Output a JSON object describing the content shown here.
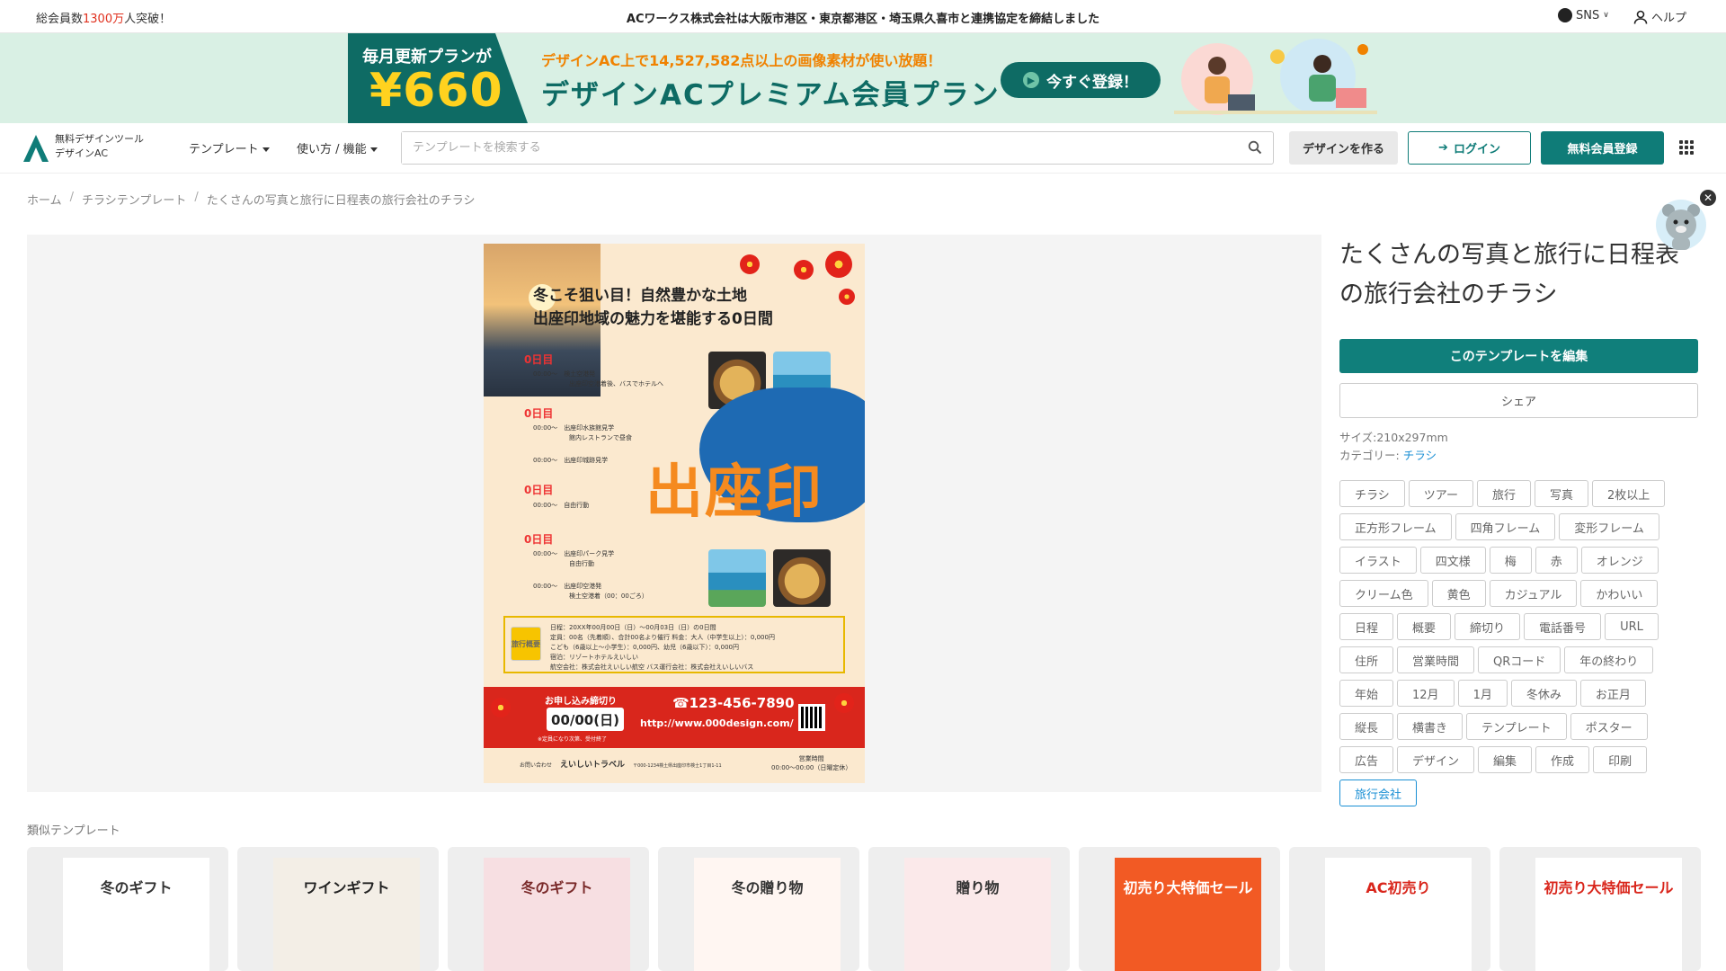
{
  "topbar": {
    "members_prefix": "総会員数",
    "members_count": "1300万",
    "members_suffix": "人突破！",
    "news": "ACワークス株式会社は大阪市港区・東京都港区・埼玉県久喜市と連携協定を締結しました",
    "sns_label": "SNS",
    "help_label": "ヘルプ"
  },
  "promo": {
    "plan_line1": "毎月更新プラン",
    "plan_line1_suffix": "が",
    "price": "¥660",
    "sub": "デザインAC上で14,527,582点以上の画像素材が使い放題！",
    "main": "デザインACプレミアム会員プラン",
    "register": "今すぐ登録！"
  },
  "header": {
    "logo_line1": "無料デザインツール",
    "logo_line2": "デザインAC",
    "nav_templates": "テンプレート",
    "nav_howto": "使い方 / 機能",
    "search_placeholder": "テンプレートを検索する",
    "make_design": "デザインを作る",
    "login": "ログイン",
    "signup": "無料会員登録"
  },
  "breadcrumb": [
    "ホーム",
    "チラシテンプレート",
    "たくさんの写真と旅行に日程表の旅行会社のチラシ"
  ],
  "flyer": {
    "headline1": "冬こそ狙い目！自然豊かな土地",
    "headline2": "出座印地域の魅力を堪能する0日間",
    "day_label": "0日目",
    "schedule": [
      {
        "time": "00:00〜",
        "text": "検土空港発",
        "text2": "出座印空港着後、バスでホテルへ"
      },
      {
        "time": "00:00〜",
        "text": "出座印水族館見学",
        "text2": "館内レストランで昼食"
      },
      {
        "time": "00:00〜",
        "text": "出座印城跡見学",
        "text2": ""
      },
      {
        "time": "00:00〜",
        "text": "自由行動",
        "text2": ""
      },
      {
        "time": "00:00〜",
        "text": "出座印パーク見学",
        "text2": "自由行動"
      },
      {
        "time": "00:00〜",
        "text": "出座印空港発",
        "text2": "検土空港着（00：00ごろ）"
      }
    ],
    "big_title": "出座印",
    "summary_tag": "旅行概要",
    "summary_lines": [
      "日程：20XX年00月00日（日）〜00月03日（日）の0日間",
      "定員：00名（先着順）、合計00名より催行 料金：大人（中学生以上）：0,000円",
      "こども（6歳以上〜小学生）：0,000円、幼児（6歳以下）：0,000円",
      "宿泊：リゾートホテルえいしい",
      "航空会社：株式会社えいしい航空 バス運行会社：株式会社えいしいバス"
    ],
    "deadline": "お申し込み締切り",
    "deadline_date": "00/00(日)",
    "deadline_note": "※定員になり次第、受付終了",
    "phone": "☎123-456-7890",
    "url": "http://www.000design.com/",
    "contact_label": "お問い合わせ",
    "company": "えいしいトラベル",
    "address": "〒000-1234検土県出座印市検士1丁目1-11",
    "hours_label": "営業時間",
    "hours": "00:00〜00:00（日曜定休）"
  },
  "detail": {
    "title": "たくさんの写真と旅行に日程表の旅行会社のチラシ",
    "edit_button": "このテンプレートを編集",
    "share_button": "シェア",
    "size_label": "サイズ:",
    "size_value": "210x297mm",
    "category_label": "カテゴリー:",
    "category_value": "チラシ",
    "tags": [
      "チラシ",
      "ツアー",
      "旅行",
      "写真",
      "2枚以上",
      "正方形フレーム",
      "四角フレーム",
      "変形フレーム",
      "イラスト",
      "四文様",
      "梅",
      "赤",
      "オレンジ",
      "クリーム色",
      "黄色",
      "カジュアル",
      "かわいい",
      "日程",
      "概要",
      "締切り",
      "電話番号",
      "URL",
      "住所",
      "営業時間",
      "QRコード",
      "年の終わり",
      "年始",
      "12月",
      "1月",
      "冬休み",
      "お正月",
      "縦長",
      "横書き",
      "テンプレート",
      "ポスター",
      "広告",
      "デザイン",
      "編集",
      "作成",
      "印刷",
      "旅行会社"
    ],
    "active_tag": "旅行会社"
  },
  "similar": {
    "label": "類似テンプレート",
    "cards": [
      {
        "title": "冬のギフト",
        "bg": "#ffffff",
        "color": "#333333"
      },
      {
        "title": "ワインギフト",
        "bg": "#f3eee6",
        "color": "#222222"
      },
      {
        "title": "冬のギフト",
        "bg": "#f7dfe2",
        "color": "#7a2a2a"
      },
      {
        "title": "冬の贈り物",
        "bg": "#fff6f2",
        "color": "#333333"
      },
      {
        "title": "贈り物",
        "bg": "#fbe9ea",
        "color": "#333333"
      },
      {
        "title": "初売り大特価セール",
        "bg": "#f25a24",
        "color": "#ffffff"
      },
      {
        "title": "AC初売り",
        "bg": "#ffffff",
        "color": "#d9261c"
      },
      {
        "title": "初売り大特価セール",
        "bg": "#ffffff",
        "color": "#d9261c"
      }
    ]
  },
  "colors": {
    "brand": "#0f7c78",
    "promo_bg": "#d9f0e4",
    "accent_red": "#e0301e",
    "link": "#1a8fd4"
  }
}
